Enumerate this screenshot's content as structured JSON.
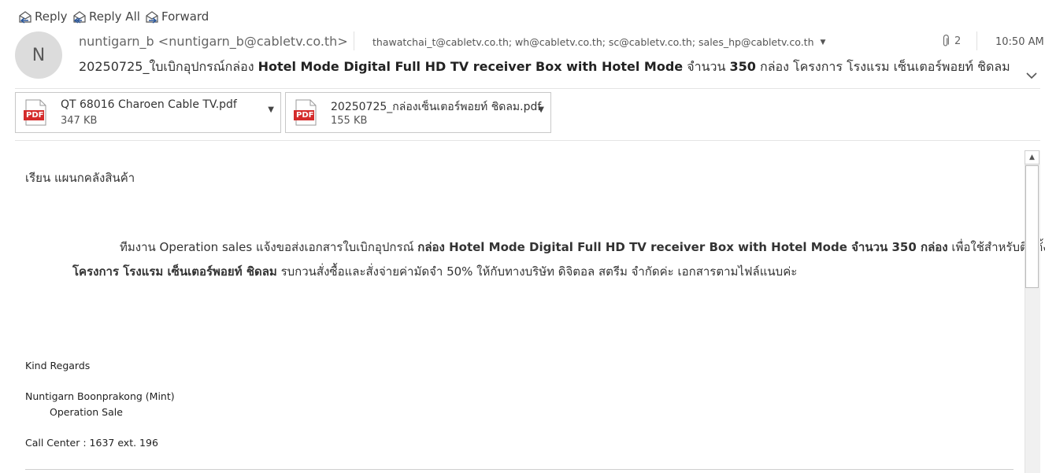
{
  "toolbar": {
    "reply_label": "Reply",
    "reply_all_label": "Reply All",
    "forward_label": "Forward"
  },
  "header": {
    "avatar_initial": "N",
    "sender": "nuntigarn_b <nuntigarn_b@cabletv.co.th>",
    "recipients": "thawatchai_t@cabletv.co.th; wh@cabletv.co.th; sc@cabletv.co.th; sales_hp@cabletv.co.th",
    "attachment_count": "2",
    "time": "10:50 AM",
    "subject_prefix": "20250725_ใบเบิกอุปกรณ์กล่อง ",
    "subject_bold1": "Hotel Mode Digital Full HD TV receiver Box with Hotel Mode",
    "subject_mid": " จำนวน ",
    "subject_bold2": "350",
    "subject_suffix": " กล่อง โครงการ โรงแรม เซ็นเตอร์พอยท์ ชิดลม"
  },
  "attachments": [
    {
      "name": "QT 68016 Charoen Cable TV.pdf",
      "size": "347 KB",
      "icon_label": "PDF"
    },
    {
      "name": "20250725_กล่องเซ็นเตอร์พอยท์ ชิดลม.pdf",
      "size": "155 KB",
      "icon_label": "PDF"
    }
  ],
  "body": {
    "greeting": "เรียน แผนกคลังสินค้า",
    "p1_a": "ทีมงาน Operation sales แจ้งขอส่งเอกสารใบเบิกอุปกรณ์ ",
    "p1_b": "กล่อง Hotel Mode Digital Full HD TV receiver Box with Hotel Mode จำนวน 350 กล่อง",
    "p1_c": " เพื่อใช้สำหรับติดตั้ง",
    "p2_a": "โครงการ โรงแรม เซ็นเตอร์พอยท์ ชิดลม",
    "p2_b": " รบกวนสั่งซื้อและสั่งจ่ายค่ามัดจำ 50% ให้กับทางบริษัท ดิจิตอล สตรีม จำกัดค่ะ เอกสารตามไฟล์แนบค่ะ"
  },
  "signature": {
    "regards": "Kind Regards",
    "name": "Nuntigarn Boonprakong (Mint)",
    "title": "Operation Sale",
    "call_center": "Call  Center   :  1637   ext.  196"
  },
  "colors": {
    "icon_blue": "#2b579a",
    "pdf_red": "#d42b2b"
  }
}
